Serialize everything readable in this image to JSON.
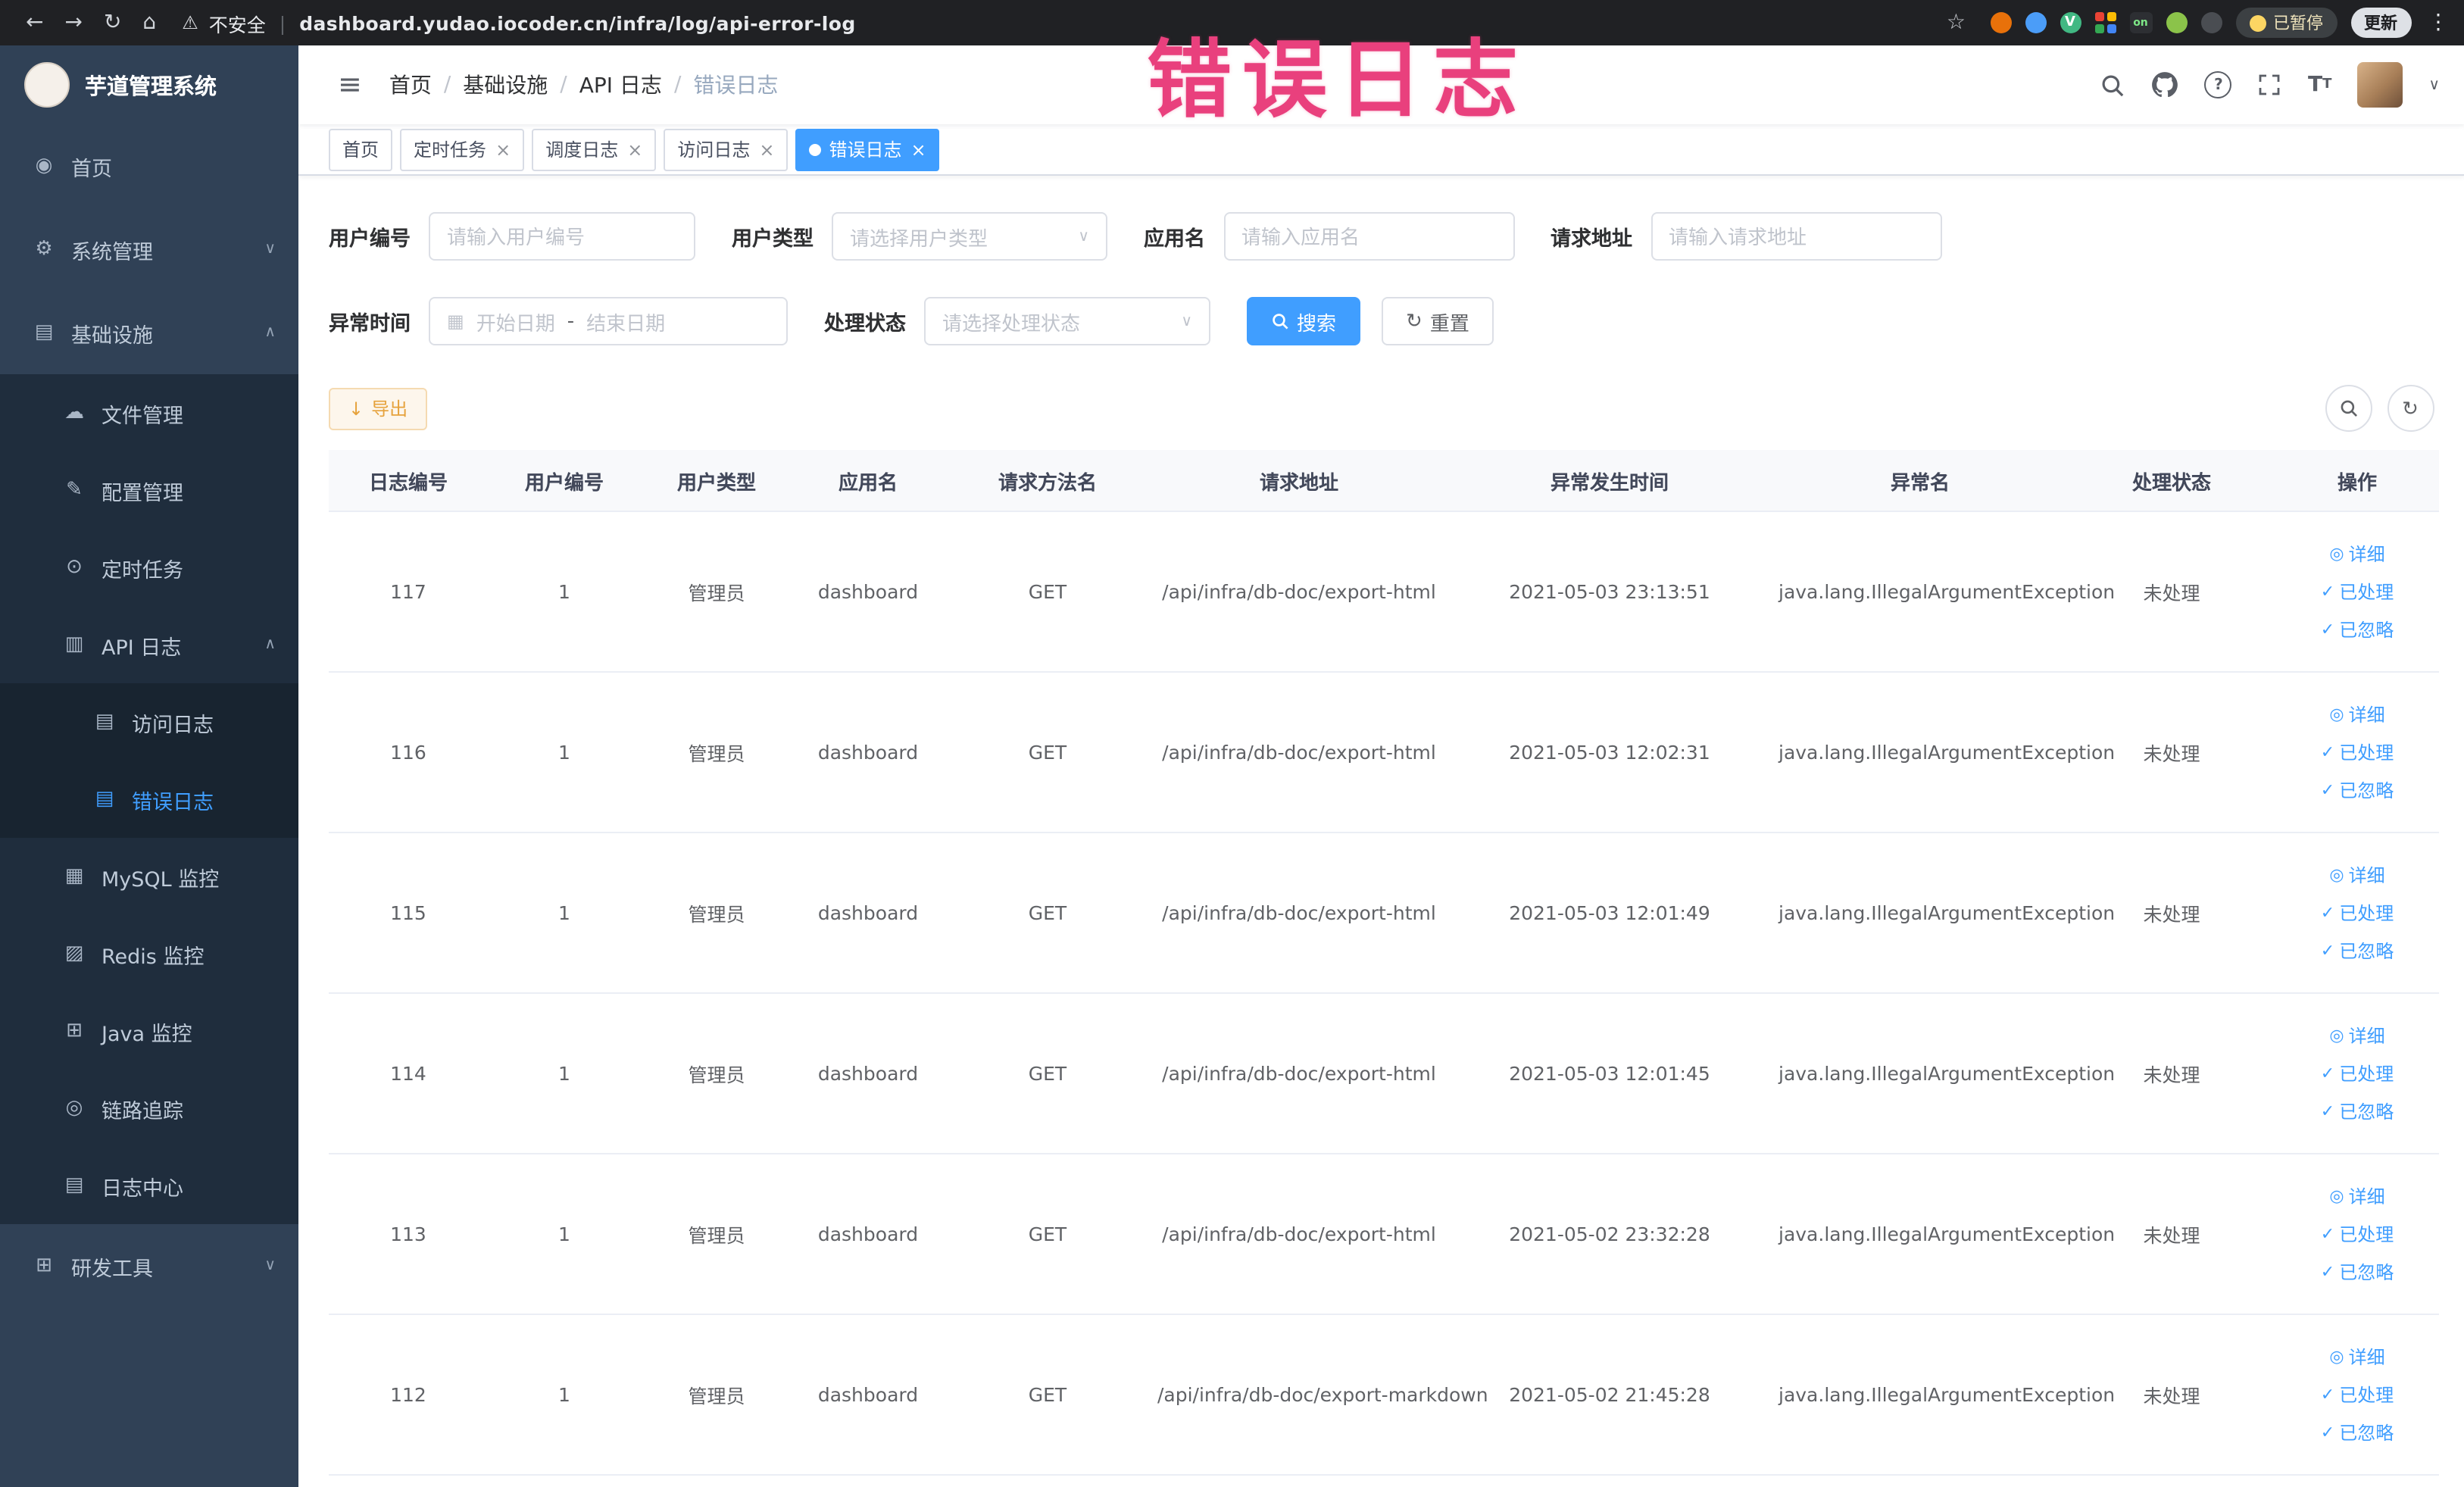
{
  "colors": {
    "accent": "#409eff",
    "sidebar_bg": "#304156",
    "submenu_bg": "#1f2d3d",
    "active_tab_bg": "#409eff",
    "export_bg": "#fdf6ec",
    "export_text": "#e6a23c",
    "overlay_text": "#e9407d"
  },
  "overlay_text": "错误日志",
  "browser": {
    "security_label": "不安全",
    "url": "dashboard.yudao.iocoder.cn/infra/log/api-error-log",
    "paused_badge_label": "已暂停",
    "update_button_label": "更新",
    "extensions": [
      {
        "id": "ext-orange",
        "shape": "circle",
        "color": "#e8710a",
        "label": ""
      },
      {
        "id": "ext-drop",
        "shape": "circle",
        "color": "#4b9df8",
        "label": ""
      },
      {
        "id": "ext-vue",
        "shape": "circle",
        "color": "#41b883",
        "label": "V"
      },
      {
        "id": "ext-grid",
        "shape": "grid",
        "color": "",
        "label": ""
      },
      {
        "id": "ext-switch",
        "shape": "badge",
        "color": "#2d2f33",
        "label": "on"
      },
      {
        "id": "ext-leaf",
        "shape": "circle",
        "color": "#8bc34a",
        "label": ""
      },
      {
        "id": "ext-dark",
        "shape": "circle",
        "color": "#4a4d52",
        "label": ""
      }
    ]
  },
  "icons": {
    "back": "←",
    "forward": "→",
    "reload": "↻",
    "home": "⌂",
    "warning": "⚠",
    "pipe": "|",
    "star": "☆",
    "kebab": "⋮",
    "hamburger": "≡",
    "breadcrumb_separator": "/",
    "chevron_down": "∨",
    "chevron_up": "∧",
    "caret_down": "∨",
    "calendar": "▦",
    "download": "↓",
    "refresh": "↻",
    "close": "×",
    "help": "?",
    "font_large": "T",
    "font_small": "T",
    "menu": {
      "dashboard": "◉",
      "gear": "⚙",
      "infrastructure": "▤",
      "file": "☁",
      "config": "✎",
      "job": "⊙",
      "api_log": "▥",
      "access_log": "▤",
      "error_log": "▤",
      "mysql": "▦",
      "redis": "▨",
      "java": "⊞",
      "trace": "◎",
      "log_center": "▤",
      "tools": "⊞"
    },
    "action": {
      "eye": "◎",
      "check": "✓"
    }
  },
  "sidebar": {
    "logo_title": "芋道管理系统",
    "items": [
      {
        "id": "home",
        "label": "首页",
        "icon": "dashboard",
        "level": 0
      },
      {
        "id": "system",
        "label": "系统管理",
        "icon": "gear",
        "level": 0,
        "chevron": "down"
      },
      {
        "id": "infrastructure",
        "label": "基础设施",
        "icon": "infrastructure",
        "level": 0,
        "chevron": "up"
      },
      {
        "id": "file-manage",
        "label": "文件管理",
        "icon": "file",
        "level": 1
      },
      {
        "id": "config-manage",
        "label": "配置管理",
        "icon": "config",
        "level": 1
      },
      {
        "id": "scheduled-job",
        "label": "定时任务",
        "icon": "job",
        "level": 1
      },
      {
        "id": "api-log",
        "label": "API 日志",
        "icon": "api_log",
        "level": 1,
        "chevron": "up"
      },
      {
        "id": "access-log",
        "label": "访问日志",
        "icon": "access_log",
        "level": 2
      },
      {
        "id": "error-log",
        "label": "错误日志",
        "icon": "error_log",
        "level": 2,
        "active": true
      },
      {
        "id": "mysql-monitor",
        "label": "MySQL 监控",
        "icon": "mysql",
        "level": 1
      },
      {
        "id": "redis-monitor",
        "label": "Redis 监控",
        "icon": "redis",
        "level": 1
      },
      {
        "id": "java-monitor",
        "label": "Java 监控",
        "icon": "java",
        "level": 1
      },
      {
        "id": "trace",
        "label": "链路追踪",
        "icon": "trace",
        "level": 1
      },
      {
        "id": "log-center",
        "label": "日志中心",
        "icon": "log_center",
        "level": 1
      },
      {
        "id": "dev-tools",
        "label": "研发工具",
        "icon": "tools",
        "level": 0,
        "chevron": "down"
      }
    ]
  },
  "breadcrumb": [
    "首页",
    "基础设施",
    "API 日志",
    "错误日志"
  ],
  "tabs": [
    {
      "id": "home",
      "label": "首页",
      "closable": false,
      "active": false
    },
    {
      "id": "scheduled-job",
      "label": "定时任务",
      "closable": true,
      "active": false
    },
    {
      "id": "schedule-log",
      "label": "调度日志",
      "closable": true,
      "active": false
    },
    {
      "id": "access-log",
      "label": "访问日志",
      "closable": true,
      "active": false
    },
    {
      "id": "error-log",
      "label": "错误日志",
      "closable": true,
      "active": true
    }
  ],
  "filters": {
    "user_id": {
      "label": "用户编号",
      "placeholder": "请输入用户编号"
    },
    "user_type": {
      "label": "用户类型",
      "placeholder": "请选择用户类型"
    },
    "app_name": {
      "label": "应用名",
      "placeholder": "请输入应用名"
    },
    "request_url": {
      "label": "请求地址",
      "placeholder": "请输入请求地址"
    },
    "exception_time": {
      "label": "异常时间",
      "start_placeholder": "开始日期",
      "separator": "-",
      "end_placeholder": "结束日期"
    },
    "process_status": {
      "label": "处理状态",
      "placeholder": "请选择处理状态"
    },
    "search_label": "搜索",
    "reset_label": "重置"
  },
  "toolbar": {
    "export_label": "导出"
  },
  "table": {
    "columns": [
      "日志编号",
      "用户编号",
      "用户类型",
      "应用名",
      "请求方法名",
      "请求地址",
      "异常发生时间",
      "异常名",
      "处理状态",
      "操作"
    ],
    "actions": [
      {
        "id": "detail",
        "label": "详细",
        "icon": "eye"
      },
      {
        "id": "processed",
        "label": "已处理",
        "icon": "check"
      },
      {
        "id": "ignored",
        "label": "已忽略",
        "icon": "check"
      }
    ],
    "rows": [
      {
        "id": "117",
        "user_id": "1",
        "user_type": "管理员",
        "app_name": "dashboard",
        "method": "GET",
        "url": "/api/infra/db-doc/export-html",
        "time": "2021-05-03 23:13:51",
        "exception": "java.lang.IllegalArgumentException",
        "status": "未处理"
      },
      {
        "id": "116",
        "user_id": "1",
        "user_type": "管理员",
        "app_name": "dashboard",
        "method": "GET",
        "url": "/api/infra/db-doc/export-html",
        "time": "2021-05-03 12:02:31",
        "exception": "java.lang.IllegalArgumentException",
        "status": "未处理"
      },
      {
        "id": "115",
        "user_id": "1",
        "user_type": "管理员",
        "app_name": "dashboard",
        "method": "GET",
        "url": "/api/infra/db-doc/export-html",
        "time": "2021-05-03 12:01:49",
        "exception": "java.lang.IllegalArgumentException",
        "status": "未处理"
      },
      {
        "id": "114",
        "user_id": "1",
        "user_type": "管理员",
        "app_name": "dashboard",
        "method": "GET",
        "url": "/api/infra/db-doc/export-html",
        "time": "2021-05-03 12:01:45",
        "exception": "java.lang.IllegalArgumentException",
        "status": "未处理"
      },
      {
        "id": "113",
        "user_id": "1",
        "user_type": "管理员",
        "app_name": "dashboard",
        "method": "GET",
        "url": "/api/infra/db-doc/export-html",
        "time": "2021-05-02 23:32:28",
        "exception": "java.lang.IllegalArgumentException",
        "status": "未处理"
      },
      {
        "id": "112",
        "user_id": "1",
        "user_type": "管理员",
        "app_name": "dashboard",
        "method": "GET",
        "url": "/api/infra/db-doc/export-markdown",
        "time": "2021-05-02 21:45:28",
        "exception": "java.lang.IllegalArgumentException",
        "status": "未处理"
      }
    ]
  }
}
